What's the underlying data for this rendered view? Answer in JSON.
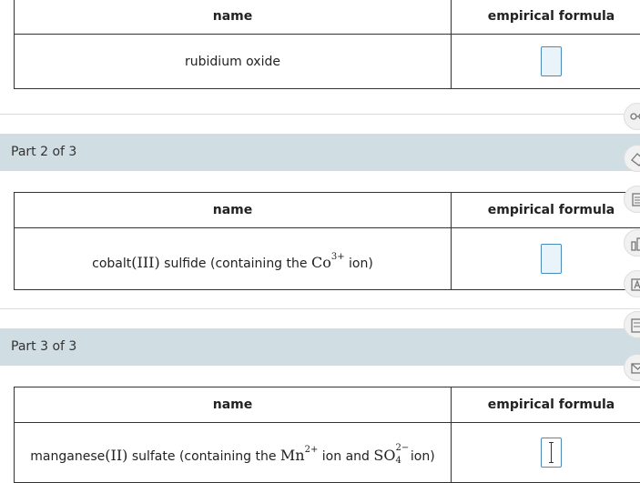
{
  "part1": {
    "header_name": "name",
    "header_formula": "empirical formula",
    "compound": "rubidium oxide"
  },
  "part2": {
    "label": "Part 2 of 3",
    "header_name": "name",
    "header_formula": "empirical formula",
    "compound_prefix": "cobalt",
    "roman": "(III)",
    "middle": " sulfide (containing the ",
    "ion_symbol": "Co",
    "ion_charge": "3+",
    "suffix": " ion)"
  },
  "part3": {
    "label": "Part 3 of 3",
    "header_name": "name",
    "header_formula": "empirical formula",
    "compound_prefix": "manganese",
    "roman": "(II)",
    "middle": " sulfate (containing the ",
    "ion1_symbol": "Mn",
    "ion1_charge": "2+",
    "and_text": " ion and ",
    "ion2_symbol": "SO",
    "ion2_sub": "4",
    "ion2_charge": "2−",
    "suffix": " ion)"
  },
  "sidebar_icons": [
    "glasses-icon",
    "eraser-icon",
    "notes-icon",
    "chart-icon",
    "periodic-table-icon",
    "calculator-icon",
    "mail-icon"
  ]
}
